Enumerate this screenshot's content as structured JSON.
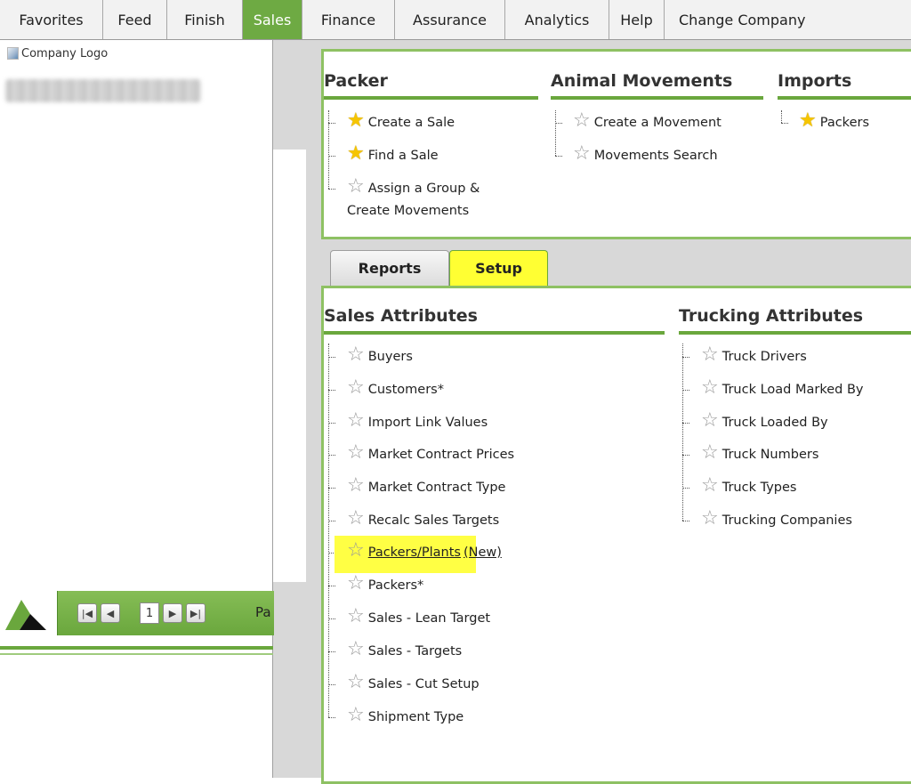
{
  "menu": {
    "items": [
      {
        "label": "Favorites",
        "active": false
      },
      {
        "label": "Feed",
        "active": false
      },
      {
        "label": "Finish",
        "active": false
      },
      {
        "label": "Sales",
        "active": true
      },
      {
        "label": "Finance",
        "active": false
      },
      {
        "label": "Assurance",
        "active": false
      },
      {
        "label": "Analytics",
        "active": false
      },
      {
        "label": "Help",
        "active": false
      },
      {
        "label": "Change Company",
        "active": false
      }
    ]
  },
  "logo": {
    "alt": "Company Logo"
  },
  "pager": {
    "page": "1",
    "label": "Pa"
  },
  "top_sections": [
    {
      "title": "Packer",
      "items": [
        {
          "label": "Create a Sale",
          "favorite": true
        },
        {
          "label": "Find a Sale",
          "favorite": true
        },
        {
          "label": "Assign a Group &",
          "label2": "Create Movements",
          "favorite": false
        }
      ]
    },
    {
      "title": "Animal Movements",
      "items": [
        {
          "label": "Create a Movement",
          "favorite": false
        },
        {
          "label": "Movements Search",
          "favorite": false
        }
      ]
    },
    {
      "title": "Imports",
      "items": [
        {
          "label": "Packers",
          "favorite": true
        }
      ]
    }
  ],
  "tabs": {
    "reports": "Reports",
    "setup": "Setup"
  },
  "sales_attributes": {
    "title": "Sales Attributes",
    "items": [
      "Buyers",
      "Customers*",
      "Import Link Values",
      "Market Contract Prices",
      "Market Contract Type",
      "Recalc Sales Targets",
      "Packers/Plants",
      "Packers*",
      "Sales - Lean Target",
      "Sales - Targets",
      "Sales - Cut Setup",
      "Shipment Type"
    ],
    "new_tag": "(New)"
  },
  "trucking_attributes": {
    "title": "Trucking Attributes",
    "items": [
      "Truck Drivers",
      "Truck Load Marked By",
      "Truck Loaded By",
      "Truck Numbers",
      "Truck Types",
      "Trucking Companies"
    ]
  },
  "colors": {
    "accent_green": "#6aa73d",
    "panel_border": "#8ec163",
    "highlight_yellow": "#ffff44",
    "star_gold": "#f6c500"
  }
}
